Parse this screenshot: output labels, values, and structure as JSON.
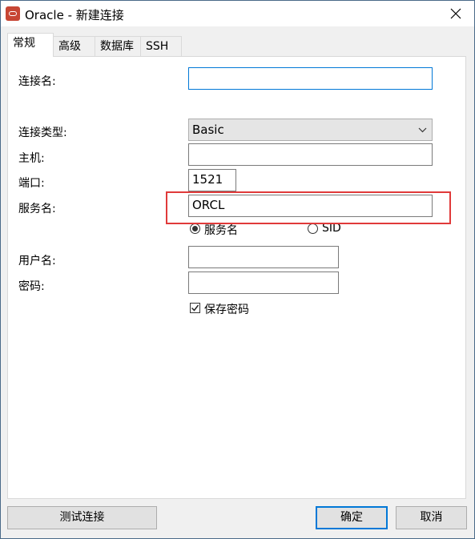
{
  "window": {
    "title": "Oracle - 新建连接"
  },
  "tabs": [
    {
      "label": "常规",
      "active": true
    },
    {
      "label": "高级",
      "active": false
    },
    {
      "label": "数据库",
      "active": false
    },
    {
      "label": "SSH",
      "active": false
    }
  ],
  "form": {
    "connection_name": {
      "label": "连接名:",
      "value": ""
    },
    "connection_type": {
      "label": "连接类型:",
      "value": "Basic"
    },
    "host": {
      "label": "主机:",
      "value": ""
    },
    "port": {
      "label": "端口:",
      "value": "1521"
    },
    "service_name": {
      "label": "服务名:",
      "value": "ORCL"
    },
    "service_type": {
      "options": [
        {
          "label": "服务名",
          "selected": true
        },
        {
          "label": "SID",
          "selected": false
        }
      ]
    },
    "username": {
      "label": "用户名:",
      "value": ""
    },
    "password": {
      "label": "密码:",
      "value": ""
    },
    "save_password": {
      "label": "保存密码",
      "checked": true
    }
  },
  "footer": {
    "test_label": "测试连接",
    "ok_label": "确定",
    "cancel_label": "取消"
  },
  "colors": {
    "brand": "#c74634",
    "highlight": "#e03a3a",
    "focus": "#0078d7"
  }
}
